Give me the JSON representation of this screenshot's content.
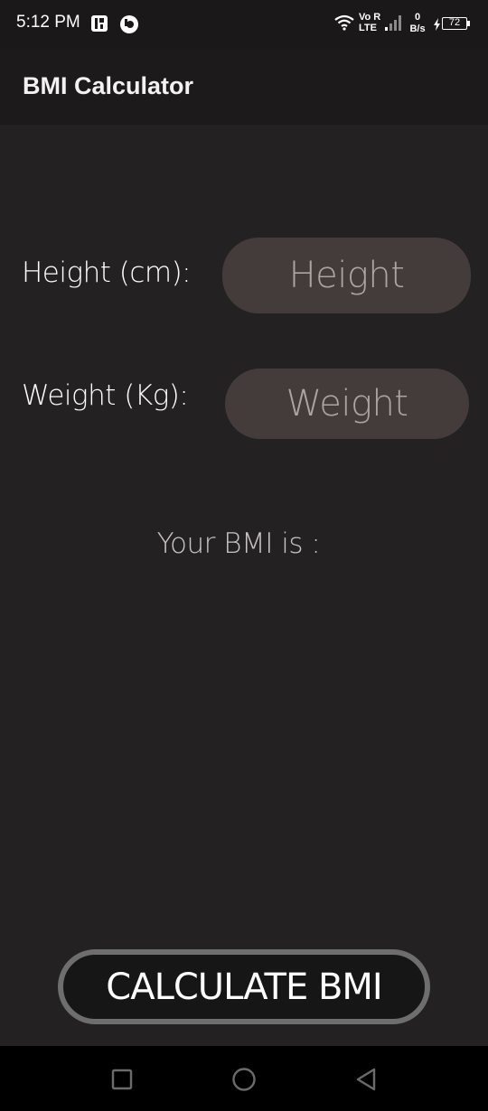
{
  "status_bar": {
    "time": "5:12 PM",
    "volte_top": "Vo R",
    "volte_bottom": "LTE",
    "net_speed_value": "0",
    "net_speed_unit": "B/s",
    "battery": "72",
    "icons": [
      "notification-app-icon",
      "circle-app-icon",
      "wifi-icon",
      "signal-icon",
      "charging-icon",
      "battery-icon"
    ]
  },
  "app_bar": {
    "title": "BMI Calculator"
  },
  "form": {
    "height_label": "Height (cm):",
    "height_placeholder": "Height",
    "height_value": "",
    "weight_label": "Weight (Kg):",
    "weight_placeholder": "Weight",
    "weight_value": ""
  },
  "result": {
    "text": "Your BMI is :"
  },
  "actions": {
    "calculate_label": "CALCULATE BMI"
  },
  "nav_bar": {
    "icons": [
      "recents-square-icon",
      "home-circle-icon",
      "back-triangle-icon"
    ]
  },
  "colors": {
    "background": "#232122",
    "app_bar": "#1c1a1b",
    "input_fill": "#433c3b",
    "button_border": "#6f6e6e",
    "button_fill": "#161617"
  }
}
